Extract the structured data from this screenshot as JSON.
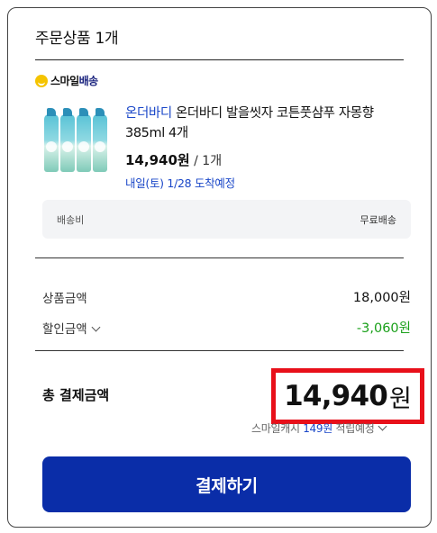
{
  "title": "주문상품 1개",
  "smile_delivery": {
    "label_prefix": "스마일",
    "label_suffix": "배송"
  },
  "product": {
    "brand": "온더바디",
    "name": " 온더바디 발을씻자 코튼풋샴푸 자몽향 385ml 4개",
    "price": "14,940원",
    "qty": " / 1개",
    "eta": "내일(토) 1/28 도착예정"
  },
  "shipping": {
    "label": "배송비",
    "value": "무료배송"
  },
  "summary": {
    "subtotal_label": "상품금액",
    "subtotal_value": "18,000원",
    "discount_label": "할인금액",
    "discount_value": "-3,060원"
  },
  "total": {
    "label": "총 결제금액",
    "amount": "14,940",
    "unit": "원"
  },
  "cashback": {
    "prefix": "스마일캐시 ",
    "amount": "149원",
    "suffix": " 적립예정"
  },
  "pay_button": "결제하기",
  "colors": {
    "primary": "#0a2da8",
    "link": "#1a47c8",
    "discount": "#1aa01a",
    "highlight": "#e8101a",
    "smile_yellow": "#f5c400"
  }
}
